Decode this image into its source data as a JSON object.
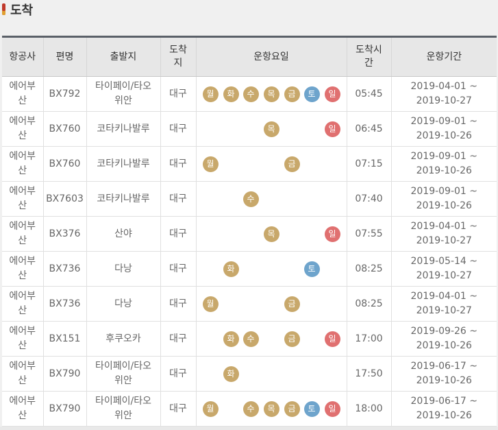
{
  "section": {
    "title": "도착"
  },
  "table": {
    "headers": {
      "airline": "항공사",
      "flight": "편명",
      "origin": "출발지",
      "dest": "도착지",
      "days": "운항요일",
      "arr_time": "도착시간",
      "period": "운항기간"
    },
    "day_labels": [
      "월",
      "화",
      "수",
      "목",
      "금",
      "토",
      "일"
    ],
    "colors": {
      "weekday": "#c8a86b",
      "saturday": "#6ea4cc",
      "sunday": "#e07070"
    },
    "rows": [
      {
        "airline": "에어부산",
        "flight": "BX792",
        "origin": "타이페이/타오위안",
        "dest": "대구",
        "days": [
          1,
          1,
          1,
          1,
          1,
          1,
          1
        ],
        "time": "05:45",
        "period": "2019-04-01 ~ 2019-10-27"
      },
      {
        "airline": "에어부산",
        "flight": "BX760",
        "origin": "코타키나발루",
        "dest": "대구",
        "days": [
          0,
          0,
          0,
          1,
          0,
          0,
          1
        ],
        "time": "06:45",
        "period": "2019-09-01 ~ 2019-10-26"
      },
      {
        "airline": "에어부산",
        "flight": "BX760",
        "origin": "코타키나발루",
        "dest": "대구",
        "days": [
          1,
          0,
          0,
          0,
          1,
          0,
          0
        ],
        "time": "07:15",
        "period": "2019-09-01 ~ 2019-10-26"
      },
      {
        "airline": "에어부산",
        "flight": "BX7603",
        "origin": "코타키나발루",
        "dest": "대구",
        "days": [
          0,
          0,
          1,
          0,
          0,
          0,
          0
        ],
        "time": "07:40",
        "period": "2019-09-01 ~ 2019-10-26"
      },
      {
        "airline": "에어부산",
        "flight": "BX376",
        "origin": "산야",
        "dest": "대구",
        "days": [
          0,
          0,
          0,
          1,
          0,
          0,
          1
        ],
        "time": "07:55",
        "period": "2019-04-01 ~ 2019-10-27"
      },
      {
        "airline": "에어부산",
        "flight": "BX736",
        "origin": "다낭",
        "dest": "대구",
        "days": [
          0,
          1,
          0,
          0,
          0,
          1,
          0
        ],
        "time": "08:25",
        "period": "2019-05-14 ~ 2019-10-27"
      },
      {
        "airline": "에어부산",
        "flight": "BX736",
        "origin": "다낭",
        "dest": "대구",
        "days": [
          1,
          0,
          0,
          0,
          1,
          0,
          0
        ],
        "time": "08:25",
        "period": "2019-04-01 ~ 2019-10-27"
      },
      {
        "airline": "에어부산",
        "flight": "BX151",
        "origin": "후쿠오카",
        "dest": "대구",
        "days": [
          0,
          1,
          1,
          0,
          1,
          0,
          1
        ],
        "time": "17:00",
        "period": "2019-09-26 ~ 2019-10-26"
      },
      {
        "airline": "에어부산",
        "flight": "BX790",
        "origin": "타이페이/타오위안",
        "dest": "대구",
        "days": [
          0,
          1,
          0,
          0,
          0,
          0,
          0
        ],
        "time": "17:50",
        "period": "2019-06-17 ~ 2019-10-26"
      },
      {
        "airline": "에어부산",
        "flight": "BX790",
        "origin": "타이페이/타오위안",
        "dest": "대구",
        "days": [
          1,
          0,
          1,
          1,
          1,
          1,
          1
        ],
        "time": "18:00",
        "period": "2019-06-17 ~ 2019-10-26"
      }
    ]
  }
}
